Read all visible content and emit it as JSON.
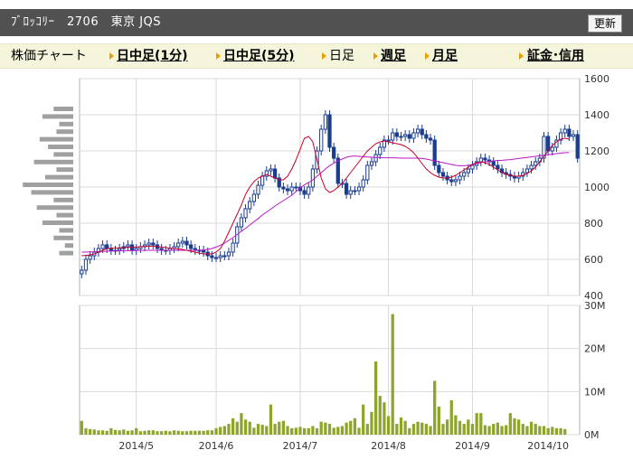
{
  "header": {
    "title": "ﾌﾞﾛｯｺﾘｰ　2706　東京 JQS",
    "refresh_label": "更新"
  },
  "nav": {
    "chart_label": "株価チャート",
    "intraday_1m": "日中足(1分)",
    "intraday_5m": "日中足(5分)",
    "daily": "日足",
    "weekly": "週足",
    "monthly": "月足",
    "margin": "証金･信用"
  },
  "colors": {
    "candle": "#1a3d8f",
    "ma_short": "#c8002a",
    "ma_long": "#b818c8",
    "volume_bar": "#8ca52a",
    "grid": "#d8d8d8",
    "profile_bar": "#a0a0a0",
    "arrow": "#e6a000"
  },
  "chart_data": {
    "type": "candlestick",
    "price_axis": {
      "ticks": [
        1600,
        1400,
        1200,
        1000,
        800,
        600,
        400
      ],
      "ylim": [
        400,
        1600
      ]
    },
    "volume_axis": {
      "ticks": [
        "30M",
        "20M",
        "10M",
        "0M"
      ],
      "ylim": [
        0,
        30
      ]
    },
    "x_ticks": [
      "2014/5",
      "2014/6",
      "2014/7",
      "2014/8",
      "2014/9",
      "2014/10"
    ],
    "price_close": [
      540,
      600,
      620,
      640,
      660,
      680,
      660,
      650,
      650,
      660,
      670,
      680,
      650,
      660,
      670,
      680,
      690,
      680,
      660,
      650,
      650,
      660,
      670,
      690,
      700,
      680,
      660,
      650,
      650,
      640,
      620,
      610,
      610,
      620,
      620,
      640,
      690,
      780,
      830,
      880,
      920,
      960,
      1010,
      1060,
      1090,
      1100,
      1050,
      1000,
      990,
      980,
      1000,
      1000,
      980,
      960,
      1000,
      1100,
      1200,
      1320,
      1400,
      1220,
      1160,
      1020,
      1020,
      960,
      980,
      980,
      1000,
      1040,
      1120,
      1140,
      1180,
      1220,
      1260,
      1260,
      1300,
      1280,
      1280,
      1290,
      1270,
      1300,
      1320,
      1290,
      1270,
      1260,
      1120,
      1080,
      1060,
      1040,
      1030,
      1040,
      1060,
      1080,
      1100,
      1120,
      1140,
      1160,
      1150,
      1140,
      1120,
      1100,
      1080,
      1070,
      1060,
      1050,
      1060,
      1080,
      1100,
      1120,
      1140,
      1160,
      1280,
      1200,
      1220,
      1260,
      1300,
      1320,
      1280,
      1290,
      1160
    ],
    "ma_short": [
      620,
      622,
      625,
      630,
      640,
      650,
      660,
      662,
      662,
      664,
      665,
      666,
      667,
      668,
      670,
      671,
      672,
      673,
      670,
      668,
      665,
      662,
      660,
      658,
      655,
      650,
      645,
      640,
      635,
      630,
      630,
      630,
      640,
      660,
      700,
      750,
      800,
      850,
      900,
      960,
      1000,
      1030,
      1050,
      1060,
      1070,
      1060,
      1050,
      1040,
      1040,
      1060,
      1100,
      1150,
      1210,
      1270,
      1280,
      1250,
      1150,
      1050,
      990,
      970,
      980,
      1000,
      1020,
      1050,
      1080,
      1110,
      1140,
      1170,
      1200,
      1220,
      1240,
      1250,
      1255,
      1250,
      1245,
      1240,
      1235,
      1225,
      1210,
      1190,
      1160,
      1130,
      1100,
      1080,
      1065,
      1055,
      1050,
      1050,
      1055,
      1065,
      1080,
      1095,
      1110,
      1125,
      1135,
      1140,
      1135,
      1125,
      1110,
      1095,
      1080,
      1070,
      1065,
      1060,
      1060,
      1065,
      1075,
      1090,
      1110,
      1140,
      1170,
      1200,
      1230,
      1250,
      1265,
      1270,
      1265
    ],
    "ma_long": [
      640,
      640,
      641,
      642,
      643,
      644,
      645,
      646,
      646,
      647,
      648,
      648,
      648,
      649,
      650,
      650,
      650,
      650,
      650,
      650,
      650,
      650,
      650,
      650,
      650,
      650,
      650,
      650,
      651,
      652,
      655,
      660,
      668,
      678,
      690,
      705,
      720,
      738,
      755,
      772,
      790,
      808,
      826,
      845,
      862,
      878,
      895,
      910,
      925,
      940,
      955,
      975,
      995,
      1012,
      1025,
      1040,
      1060,
      1080,
      1100,
      1118,
      1132,
      1145,
      1155,
      1165,
      1170,
      1172,
      1170,
      1168,
      1166,
      1165,
      1164,
      1163,
      1162,
      1162,
      1162,
      1161,
      1160,
      1160,
      1160,
      1160,
      1160,
      1158,
      1155,
      1150,
      1145,
      1140,
      1135,
      1130,
      1125,
      1120,
      1118,
      1118,
      1120,
      1125,
      1130,
      1135,
      1140,
      1143,
      1145,
      1147,
      1148,
      1150,
      1152,
      1155,
      1158,
      1161,
      1164,
      1167,
      1170,
      1173,
      1176,
      1179,
      1182,
      1185,
      1188,
      1190,
      1191
    ],
    "volume": [
      3.2,
      1.5,
      1.3,
      1.2,
      1.0,
      1.0,
      0.9,
      1.5,
      1.1,
      1.0,
      1.2,
      0.9,
      1.0,
      1.5,
      0.8,
      0.9,
      1.0,
      1.0,
      0.8,
      0.8,
      0.9,
      0.8,
      1.0,
      0.9,
      0.8,
      0.8,
      0.9,
      0.9,
      0.9,
      0.9,
      1.0,
      1.0,
      1.5,
      1.8,
      2.0,
      2.5,
      3.8,
      3.0,
      5.0,
      3.5,
      3.0,
      1.6,
      2.5,
      2.3,
      2.0,
      7.0,
      2.5,
      3.0,
      3.2,
      2.0,
      1.5,
      1.6,
      1.8,
      1.5,
      1.5,
      2.0,
      1.5,
      3.0,
      2.8,
      2.5,
      1.6,
      1.8,
      2.0,
      2.8,
      3.2,
      3.8,
      1.6,
      7.0,
      2.5,
      5.3,
      17.0,
      9.0,
      7.5,
      4.3,
      28.0,
      2.5,
      4.0,
      3.2,
      1.5,
      2.5,
      3.0,
      2.8,
      2.5,
      2.0,
      12.5,
      6.5,
      2.5,
      3.5,
      8.0,
      4.5,
      3.2,
      2.5,
      3.5,
      2.5,
      5.0,
      5.0,
      2.2,
      2.0,
      2.5,
      2.8,
      2.0,
      2.2,
      5.0,
      3.8,
      3.5,
      2.5,
      2.0,
      3.0,
      2.5,
      2.0,
      2.0,
      1.5,
      1.8,
      1.5,
      1.5,
      1.3
    ],
    "price_profile": [
      0.35,
      0.55,
      0.25,
      0.3,
      0.6,
      0.45,
      0.35,
      0.7,
      0.3,
      0.5,
      0.9,
      0.75,
      0.35,
      0.65,
      0.3,
      0.55,
      0.25,
      0.35,
      0.15,
      0.25
    ]
  }
}
